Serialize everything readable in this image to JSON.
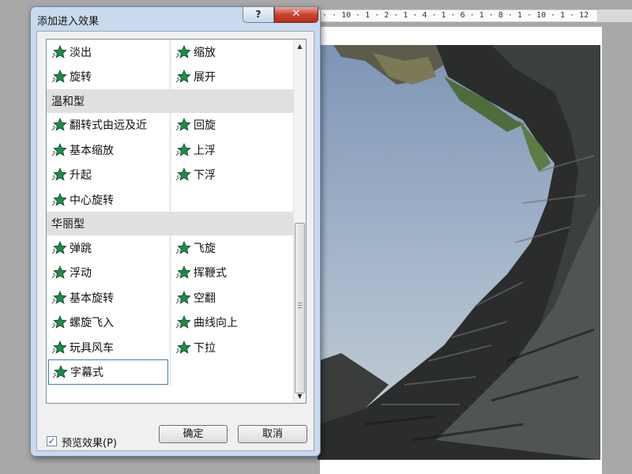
{
  "dialog": {
    "title": "添加进入效果",
    "help_label": "?",
    "close_label": "✕"
  },
  "ruler": {
    "text": "· · 10 · 1 · 2 · 1 · 4 · 1 · 6 · 1 · 8 · 1 · 10 · 1 · 12"
  },
  "list": {
    "sections": [
      {
        "category": "",
        "left": [
          "淡出",
          "旋转"
        ],
        "right": [
          "缩放",
          "展开"
        ]
      },
      {
        "category": "温和型",
        "left": [
          "翻转式由远及近",
          "基本缩放",
          "升起",
          "中心旋转"
        ],
        "right": [
          "回旋",
          "上浮",
          "下浮"
        ]
      },
      {
        "category": "华丽型",
        "left": [
          "弹跳",
          "浮动",
          "基本旋转",
          "螺旋飞入",
          "玩具风车",
          "字幕式"
        ],
        "right": [
          "飞旋",
          "挥鞭式",
          "空翻",
          "曲线向上",
          "下拉"
        ]
      }
    ],
    "selected": "字幕式"
  },
  "scrollbar": {
    "up_glyph": "▲",
    "down_glyph": "▼"
  },
  "footer": {
    "preview_checked": true,
    "check_glyph": "✓",
    "preview_label": "预览效果(P)",
    "ok_label": "确定",
    "cancel_label": "取消"
  },
  "icons": {
    "effect_icon": "green-star-icon",
    "star_color": "#1f8a4c",
    "star_dark": "#0d4d28"
  }
}
